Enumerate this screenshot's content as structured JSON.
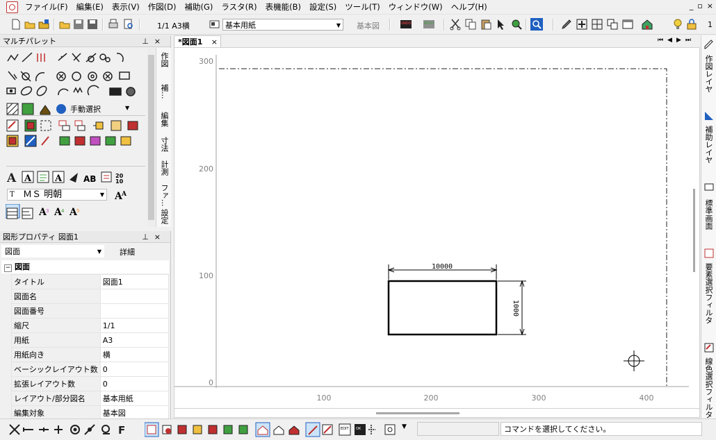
{
  "menubar": {
    "items": [
      "ファイル(F)",
      "編集(E)",
      "表示(V)",
      "作図(D)",
      "補助(G)",
      "ラスタ(R)",
      "表機能(B)",
      "設定(S)",
      "ツール(T)",
      "ウィンドウ(W)",
      "ヘルプ(H)"
    ],
    "window_controls": [
      "_",
      "▫",
      "×"
    ]
  },
  "toolbar": {
    "scale": "1/1 A3横",
    "paper": "基本用紙",
    "view": "基本図",
    "page_number": "1"
  },
  "palette": {
    "title": "マルチパレット",
    "tabs": [
      "作図",
      "補...",
      "編集",
      "寸法",
      "計測",
      "ファ...",
      "設定"
    ],
    "select_mode": "手動選択",
    "font": "ＭＳ 明朝",
    "font_prefix": "T"
  },
  "properties": {
    "title": "図形プロパティ 図面1",
    "object_select": "図面",
    "detail_button": "詳細",
    "section": "図面",
    "rows": [
      {
        "key": "タイトル",
        "value": "図面1"
      },
      {
        "key": "図面名",
        "value": ""
      },
      {
        "key": "図面番号",
        "value": ""
      },
      {
        "key": "縮尺",
        "value": "1/1"
      },
      {
        "key": "用紙",
        "value": "A3"
      },
      {
        "key": "用紙向き",
        "value": "横"
      },
      {
        "key": "ベーシックレイアウト数",
        "value": "0"
      },
      {
        "key": "拡張レイアウト数",
        "value": "0"
      },
      {
        "key": "レイアウト/部分図名",
        "value": "基本用紙"
      },
      {
        "key": "編集対象",
        "value": "基本図"
      }
    ]
  },
  "document": {
    "tab_label": "*図面1",
    "y_ticks": [
      "300",
      "200",
      "100",
      "0"
    ],
    "x_ticks": [
      "100",
      "200",
      "300",
      "400"
    ],
    "dimension_horizontal": "10000",
    "dimension_vertical": "1000"
  },
  "right_panel": {
    "tabs": [
      "作図レイヤ",
      "補助レイヤ",
      "標準画面",
      "要素選択フィルタ",
      "線色選択フィルタ"
    ]
  },
  "status": {
    "message": "コマンドを選択してください。"
  },
  "colors": {
    "accent_blue": "#2060c0",
    "accent_red": "#c03030",
    "canvas_bg": "#ffffff"
  }
}
